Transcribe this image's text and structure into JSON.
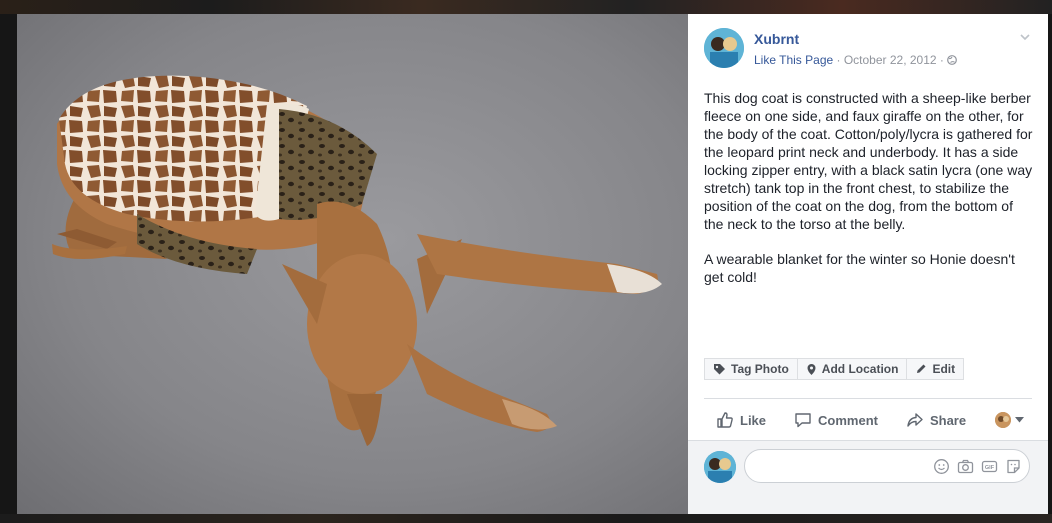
{
  "photo": {
    "alt_icon": "dog-photo"
  },
  "post": {
    "page_name": "Xubrnt",
    "like_page_label": "Like This Page",
    "sep1": " · ",
    "date": "October 22, 2012",
    "sep2": " · ",
    "privacy_icon": "globe-icon",
    "menu_icon": "chevron-down-icon",
    "caption_p1": "This dog coat is constructed with a sheep-like berber fleece on one side, and faux giraffe on the other, for the body of the coat. Cotton/poly/lycra is gathered for the leopard print neck and underbody. It has a side locking zipper entry, with a black satin lycra (one way stretch) tank top in the front chest, to stabilize the position of the coat on the dog, from the bottom of the neck to the torso at the belly.",
    "caption_p2": "A wearable blanket for the winter so Honie doesn't get cold!"
  },
  "photo_actions": {
    "tag_label": "Tag Photo",
    "location_label": "Add Location",
    "edit_label": "Edit"
  },
  "reactions": {
    "like_label": "Like",
    "comment_label": "Comment",
    "share_label": "Share"
  },
  "comment": {
    "placeholder": ""
  },
  "colors": {
    "link": "#365899",
    "muted": "#90949c",
    "text": "#1d2129"
  }
}
